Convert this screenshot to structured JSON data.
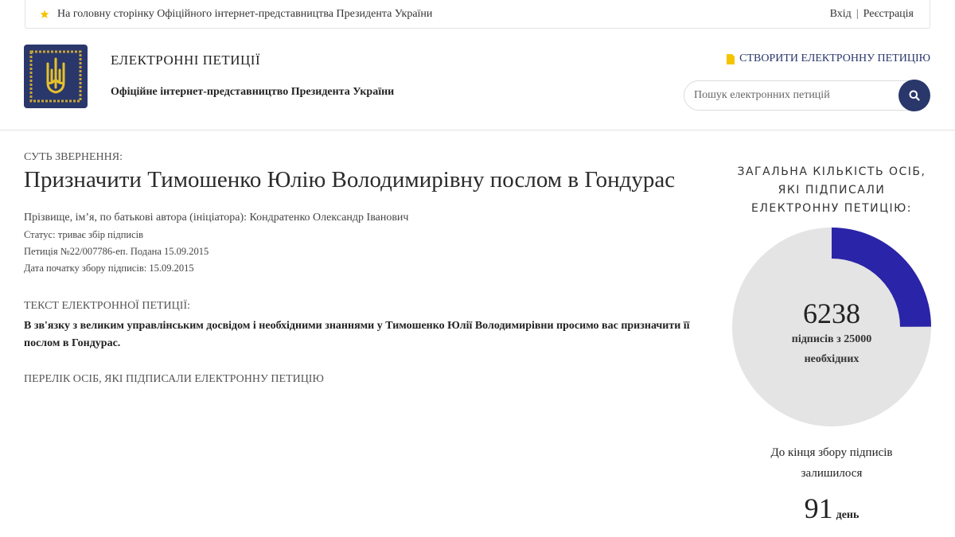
{
  "topbar": {
    "home_link": "На головну сторінку Офіційного інтернет-представництва Президента України",
    "login": "Вхід",
    "separator": "|",
    "register": "Реєстрація"
  },
  "header": {
    "title": "ЕЛЕКТРОННІ ПЕТИЦІЇ",
    "subtitle": "Офіційне інтернет-представництво Президента України",
    "create_label": "СТВОРИТИ ЕЛЕКТРОННУ ПЕТИЦІЮ",
    "search_placeholder": "Пошук електронних петицій"
  },
  "petition": {
    "essence_label": "СУТЬ ЗВЕРНЕННЯ:",
    "title": "Призначити Тимошенко Юлію Володимирівну послом в Гондурас",
    "author": "Прізвище, ім’я, по батькові автора (ініціатора): Кондратенко Олександр Іванович",
    "status": "Статус: триває збір підписів",
    "number": "Петиція №22/007786-еп. Подана 15.09.2015",
    "start_date": "Дата початку збору підписів: 15.09.2015",
    "text_label": "ТЕКСТ ЕЛЕКТРОННОЇ ПЕТИЦІЇ:",
    "text": "В зв'язку з великим управлінським досвідом і необхідними знаннями у Тимошенко Юлії Володимирівни просимо вас призначити її послом в Гондурас.",
    "signers_link": "ПЕРЕЛІК ОСІБ, ЯКІ ПІДПИСАЛИ ЕЛЕКТРОННУ ПЕТИЦІЮ"
  },
  "stats": {
    "total_label_1": "ЗАГАЛЬНА КІЛЬКІСТЬ ОСІБ,",
    "total_label_2": "ЯКІ ПІДПИСАЛИ",
    "total_label_3": "ЕЛЕКТРОННУ ПЕТИЦІЮ:",
    "signatures": "6238",
    "signatures_value": 6238,
    "required_value": 25000,
    "of_required_1": "підписів з 25000",
    "of_required_2": "необхідних",
    "remaining_1": "До кінця збору підписів",
    "remaining_2": "залишилося",
    "days": "91",
    "days_unit": "день"
  },
  "colors": {
    "brand": "#29376b",
    "progress": "#2a24a8",
    "track": "#e4e4e4",
    "accent": "#f5c400"
  }
}
